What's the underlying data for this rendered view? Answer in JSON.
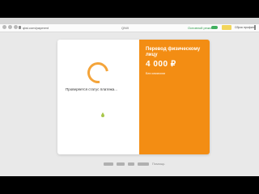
{
  "browser": {
    "url": "qiwi.com/payment",
    "tab_title": "QIWI",
    "status_label": "Основной режим",
    "user_label": "Сброс профиля"
  },
  "payment": {
    "status_text": "Проверяется статус платежа...",
    "title": "Перевод физическому лицу",
    "amount": "4 000 ₽",
    "fee_text": "Без комиссии"
  },
  "footer": {
    "text": "Помощь"
  },
  "colors": {
    "accent": "#f38d13",
    "spinner": "#f4a43a",
    "background": "#e9e9e9"
  }
}
